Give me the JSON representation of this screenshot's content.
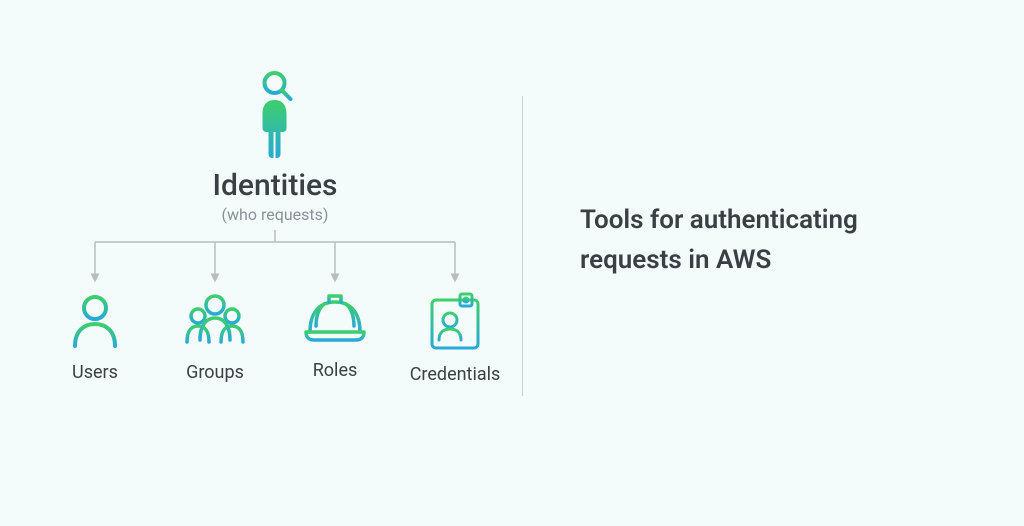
{
  "left": {
    "title": "Identities",
    "subtitle": "(who requests)",
    "children": [
      {
        "label": "Users"
      },
      {
        "label": "Groups"
      },
      {
        "label": "Roles"
      },
      {
        "label": "Credentials"
      }
    ]
  },
  "right": {
    "title": "Tools for authenticating requests in AWS"
  },
  "colors": {
    "gradStart": "#3dcf6b",
    "gradEnd": "#28a9d8",
    "connector": "#b6bcc0"
  }
}
